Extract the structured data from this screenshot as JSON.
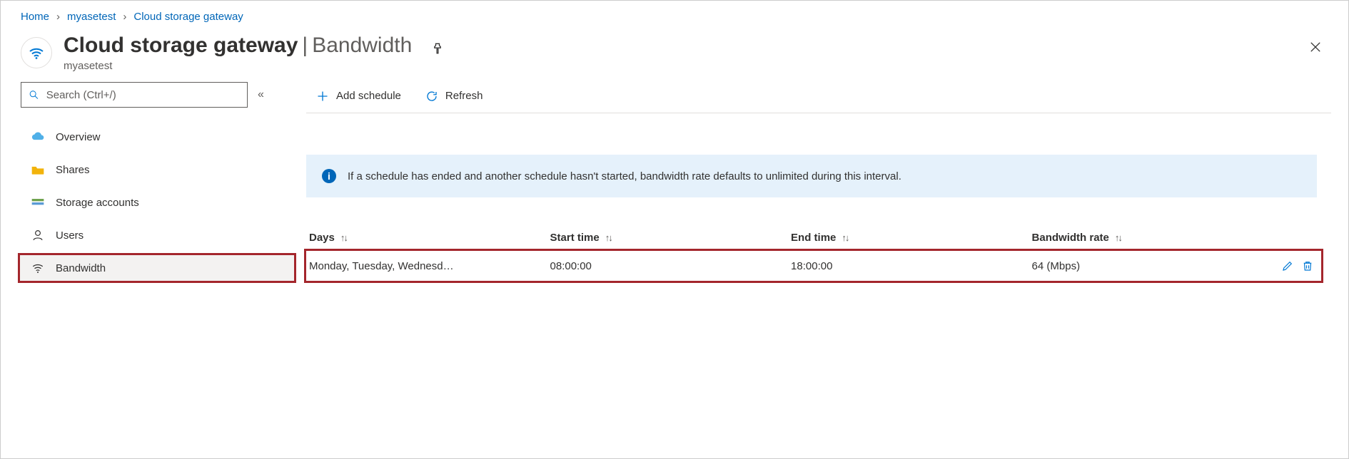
{
  "breadcrumb": {
    "items": [
      "Home",
      "myasetest",
      "Cloud storage gateway"
    ]
  },
  "header": {
    "title": "Cloud storage gateway",
    "section": "Bandwidth",
    "subtitle": "myasetest"
  },
  "search": {
    "placeholder": "Search (Ctrl+/)"
  },
  "sidebar": {
    "items": [
      {
        "key": "overview",
        "label": "Overview",
        "icon": "cloud-icon"
      },
      {
        "key": "shares",
        "label": "Shares",
        "icon": "folder-icon"
      },
      {
        "key": "storage",
        "label": "Storage accounts",
        "icon": "storage-icon"
      },
      {
        "key": "users",
        "label": "Users",
        "icon": "person-icon"
      },
      {
        "key": "bandwidth",
        "label": "Bandwidth",
        "icon": "wifi-icon"
      }
    ],
    "active": "bandwidth"
  },
  "toolbar": {
    "add": "Add schedule",
    "refresh": "Refresh"
  },
  "info_banner": "If a schedule has ended and another schedule hasn't started, bandwidth rate defaults to unlimited during this interval.",
  "table": {
    "columns": {
      "days": "Days",
      "start": "Start time",
      "end": "End time",
      "rate": "Bandwidth rate"
    },
    "rows": [
      {
        "days": "Monday, Tuesday, Wednesd…",
        "start": "08:00:00",
        "end": "18:00:00",
        "rate": "64 (Mbps)"
      }
    ]
  }
}
